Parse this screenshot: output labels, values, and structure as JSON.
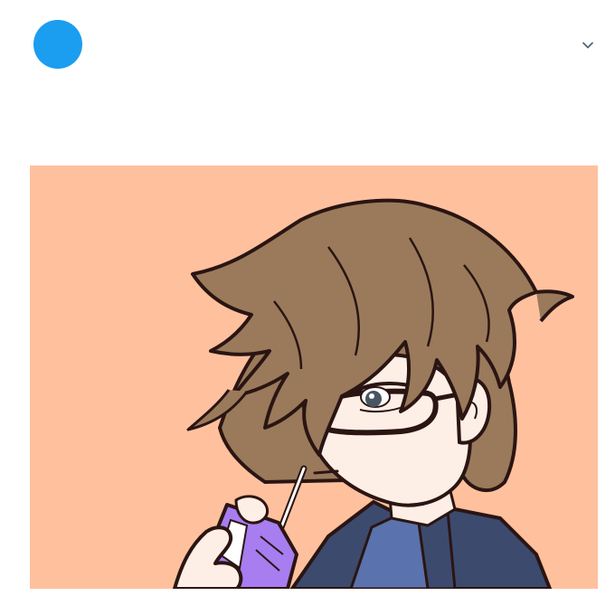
{
  "header": {
    "avatar_icon": "avatar-circle",
    "avatar_color": "#1b9df0",
    "menu_icon": "chevron-down-icon",
    "menu_icon_color": "#536471"
  },
  "media": {
    "background_color": "#ffc09e",
    "hair_color": "#9a7a5b",
    "skin_color": "#fdeee6",
    "outline_color": "#2a1512",
    "clothing_color": "#3c4a6e",
    "inner_collar_color": "#5a72ad",
    "drink_box_color": "#a77df0"
  }
}
